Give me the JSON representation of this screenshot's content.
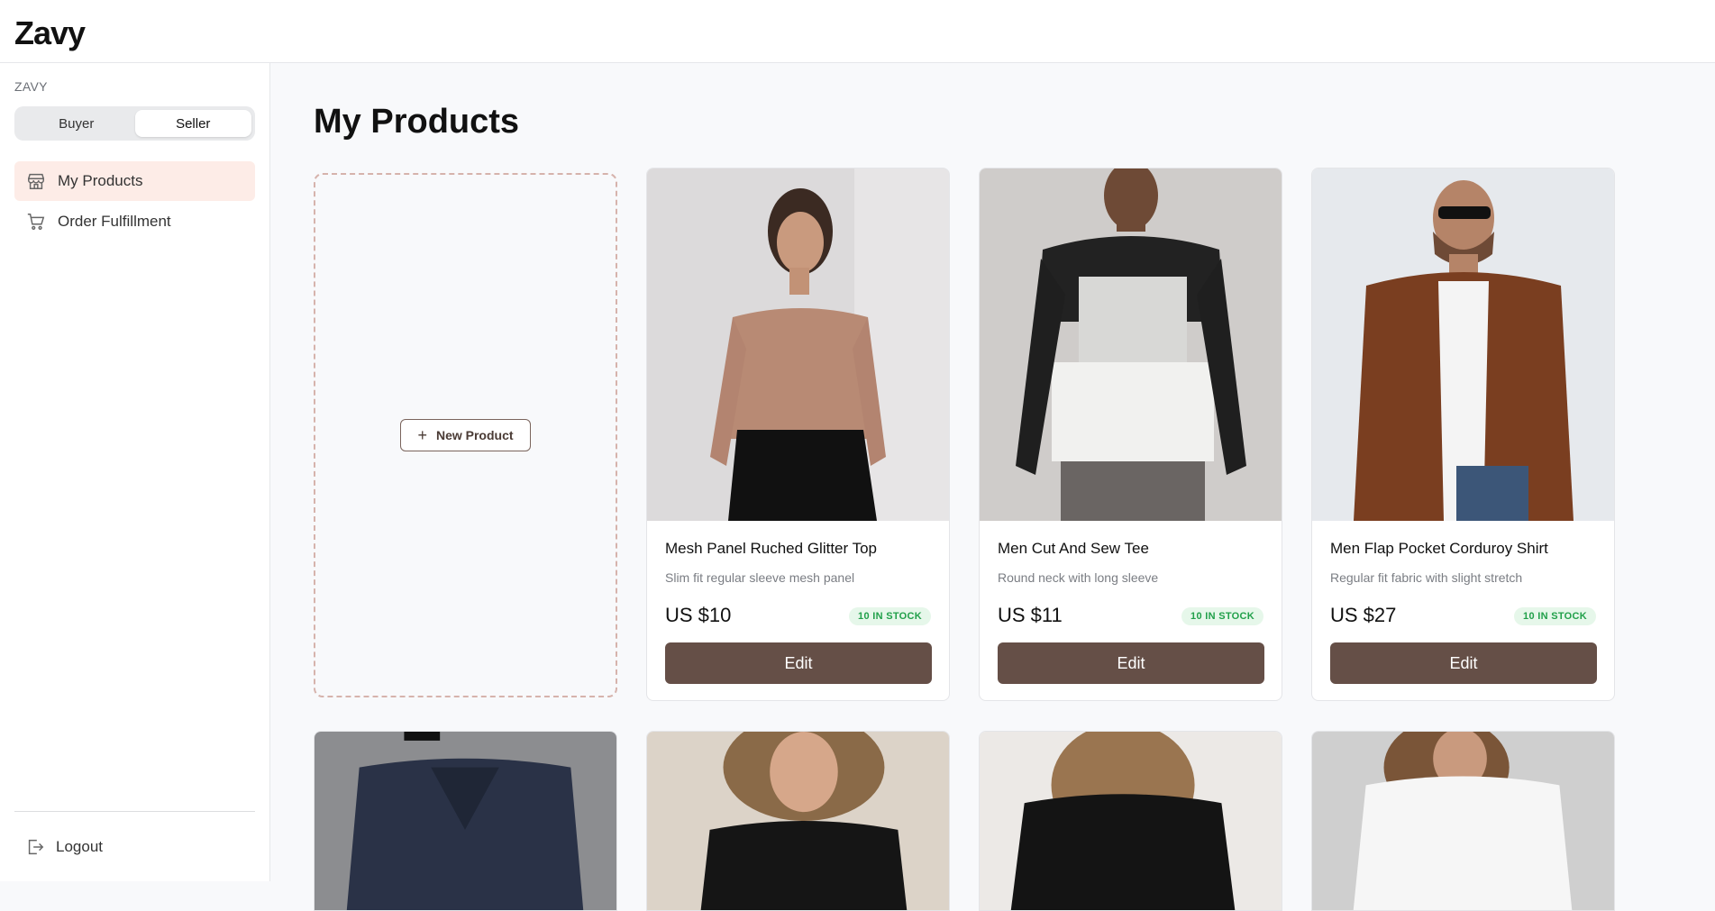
{
  "app": {
    "logo": "Zavy"
  },
  "sidebar": {
    "section_label": "ZAVY",
    "mode_toggle": {
      "buyer": "Buyer",
      "seller": "Seller",
      "selected": "Seller"
    },
    "items": [
      {
        "label": "My Products",
        "icon": "store-icon",
        "active": true
      },
      {
        "label": "Order Fulfillment",
        "icon": "cart-icon",
        "active": false
      }
    ],
    "logout": {
      "label": "Logout",
      "icon": "logout-icon"
    }
  },
  "main": {
    "title": "My Products",
    "new_product_label": "New Product",
    "products": [
      {
        "name": "Mesh Panel Ruched Glitter Top",
        "desc": "Slim fit regular sleeve mesh panel",
        "price": "US $10",
        "stock": "10 IN STOCK",
        "edit": "Edit"
      },
      {
        "name": "Men Cut And Sew Tee",
        "desc": "Round neck with long sleeve",
        "price": "US $11",
        "stock": "10 IN STOCK",
        "edit": "Edit"
      },
      {
        "name": "Men Flap Pocket Corduroy Shirt",
        "desc": "Regular fit fabric with slight stretch",
        "price": "US $27",
        "stock": "10 IN STOCK",
        "edit": "Edit"
      }
    ]
  },
  "colors": {
    "accent": "#654f47",
    "active_nav_bg": "#fdece7",
    "stock_green": "#21a04a",
    "dashed_border": "#d6b3ac"
  }
}
